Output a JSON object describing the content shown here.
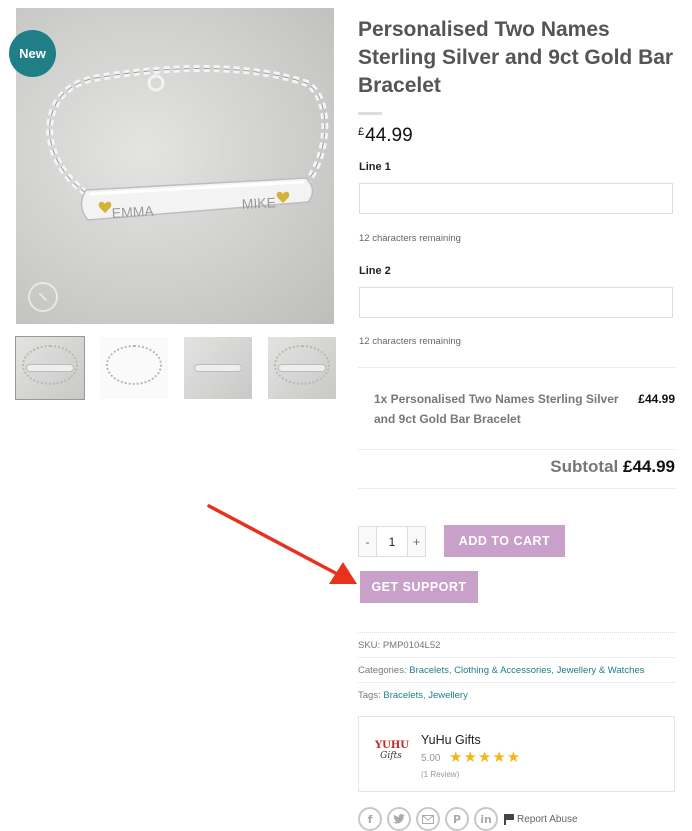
{
  "product": {
    "badge": "New",
    "title": "Personalised Two Names Sterling Silver and 9ct Gold Bar Bracelet",
    "currency_symbol": "£",
    "price": "44.99",
    "engraving_left": "EMMA",
    "engraving_right": "MIKE"
  },
  "gallery": {
    "thumbnail_count": 4
  },
  "options": {
    "line1": {
      "label": "Line 1",
      "value": "",
      "remaining": "12 characters remaining"
    },
    "line2": {
      "label": "Line 2",
      "value": "",
      "remaining": "12 characters remaining"
    }
  },
  "summary": {
    "item": "1x Personalised Two Names Sterling Silver and 9ct Gold Bar Bracelet",
    "item_price": "£44.99",
    "subtotal_label": "Subtotal",
    "subtotal_value": "£44.99"
  },
  "cart": {
    "minus": "-",
    "quantity": "1",
    "plus": "+",
    "add_to_cart": "ADD TO CART",
    "get_support": "GET SUPPORT"
  },
  "meta": {
    "sku_label": "SKU:",
    "sku": "PMP0104L52",
    "categories_label": "Categories:",
    "categories": [
      "Bracelets",
      "Clothing & Accessories",
      "Jewellery & Watches"
    ],
    "tags_label": "Tags:",
    "tags": [
      "Bracelets",
      "Jewellery"
    ]
  },
  "vendor": {
    "logo_line1": "YUHU",
    "logo_line2": "Gifts",
    "name": "YuHu Gifts",
    "rating": "5.00",
    "stars": "★★★★★",
    "reviews": "(1 Review)"
  },
  "share": {
    "icons": [
      "facebook-icon",
      "twitter-icon",
      "email-icon",
      "pinterest-icon",
      "linkedin-icon"
    ],
    "report_abuse": "Report Abuse"
  },
  "colors": {
    "accent_teal": "#1f7e86",
    "button_purple": "#c9a0c9",
    "star_gold": "#f3b518",
    "arrow_red": "#e8321e"
  }
}
